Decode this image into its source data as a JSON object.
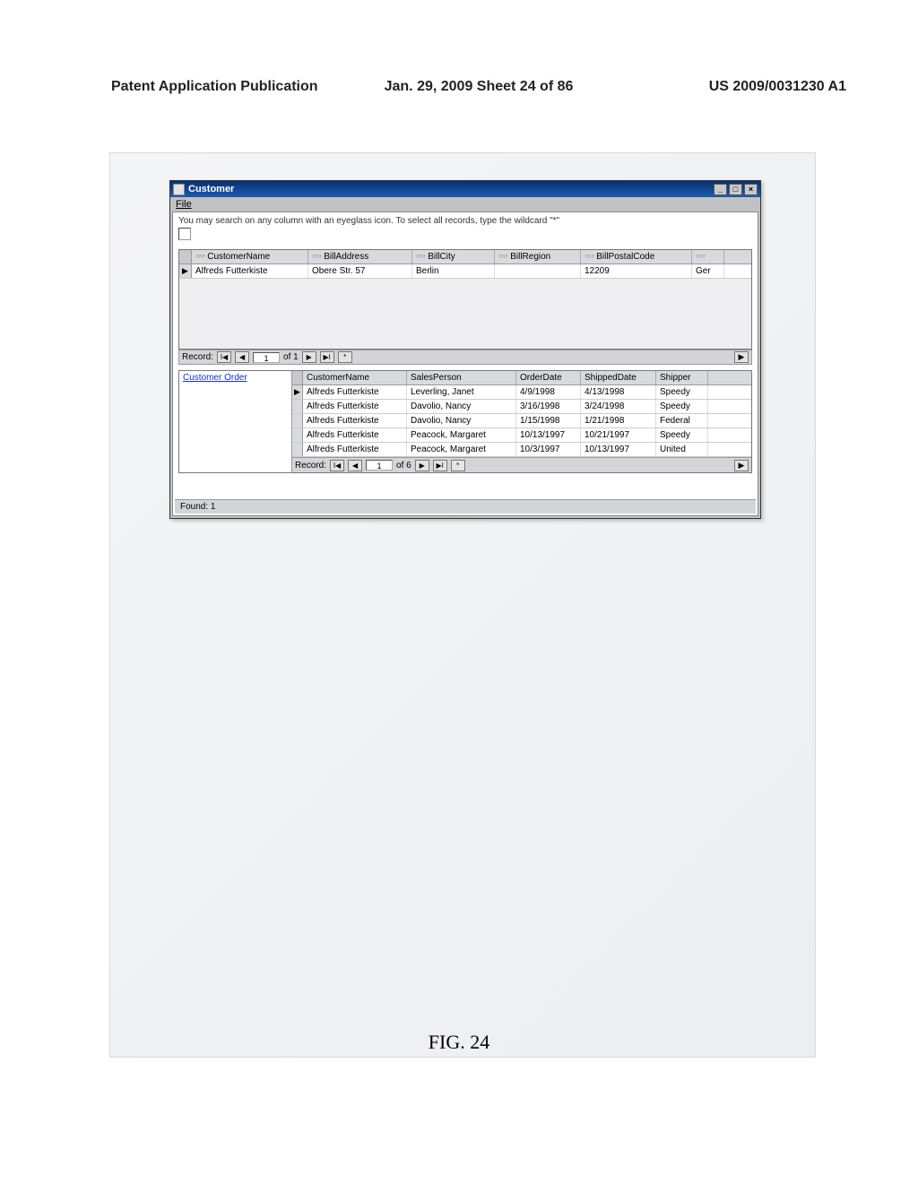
{
  "doc": {
    "header_left": "Patent Application Publication",
    "header_center": "Jan. 29, 2009  Sheet 24 of 86",
    "header_right": "US 2009/0031230 A1",
    "figure_caption": "FIG. 24"
  },
  "window": {
    "title": "Customer",
    "menu_file": "File",
    "hint": "You may search on any column with an eyeglass icon. To select all records, type the wildcard \"*\"",
    "status": "Found: 1"
  },
  "main_grid": {
    "headers": [
      "CustomerName",
      "BillAddress",
      "BillCity",
      "BillRegion",
      "BillPostalCode",
      ""
    ],
    "eyeglass_prefix": "👓",
    "row": {
      "marker": "▶",
      "cells": [
        "Alfreds Futterkiste",
        "Obere Str. 57",
        "Berlin",
        "",
        "12209",
        "Ger"
      ]
    },
    "rec": {
      "label": "Record:",
      "pos": "1",
      "of": "of 1"
    }
  },
  "tree": {
    "item": "Customer Order"
  },
  "sub_grid": {
    "headers": [
      "CustomerName",
      "SalesPerson",
      "OrderDate",
      "ShippedDate",
      "Shipper"
    ],
    "rows": [
      {
        "marker": "▶",
        "cells": [
          "Alfreds Futterkiste",
          "Leverling, Janet",
          "4/9/1998",
          "4/13/1998",
          "Speedy"
        ]
      },
      {
        "marker": "",
        "cells": [
          "Alfreds Futterkiste",
          "Davolio, Nancy",
          "3/16/1998",
          "3/24/1998",
          "Speedy"
        ]
      },
      {
        "marker": "",
        "cells": [
          "Alfreds Futterkiste",
          "Davolio, Nancy",
          "1/15/1998",
          "1/21/1998",
          "Federal"
        ]
      },
      {
        "marker": "",
        "cells": [
          "Alfreds Futterkiste",
          "Peacock, Margaret",
          "10/13/1997",
          "10/21/1997",
          "Speedy"
        ]
      },
      {
        "marker": "",
        "cells": [
          "Alfreds Futterkiste",
          "Peacock, Margaret",
          "10/3/1997",
          "10/13/1997",
          "United"
        ]
      }
    ],
    "rec": {
      "label": "Record:",
      "pos": "1",
      "of": "of 6"
    }
  },
  "nav": {
    "first": "I◀",
    "prev": "◀",
    "next": "▶",
    "last": "▶I",
    "new": "*",
    "hend": "▶"
  }
}
